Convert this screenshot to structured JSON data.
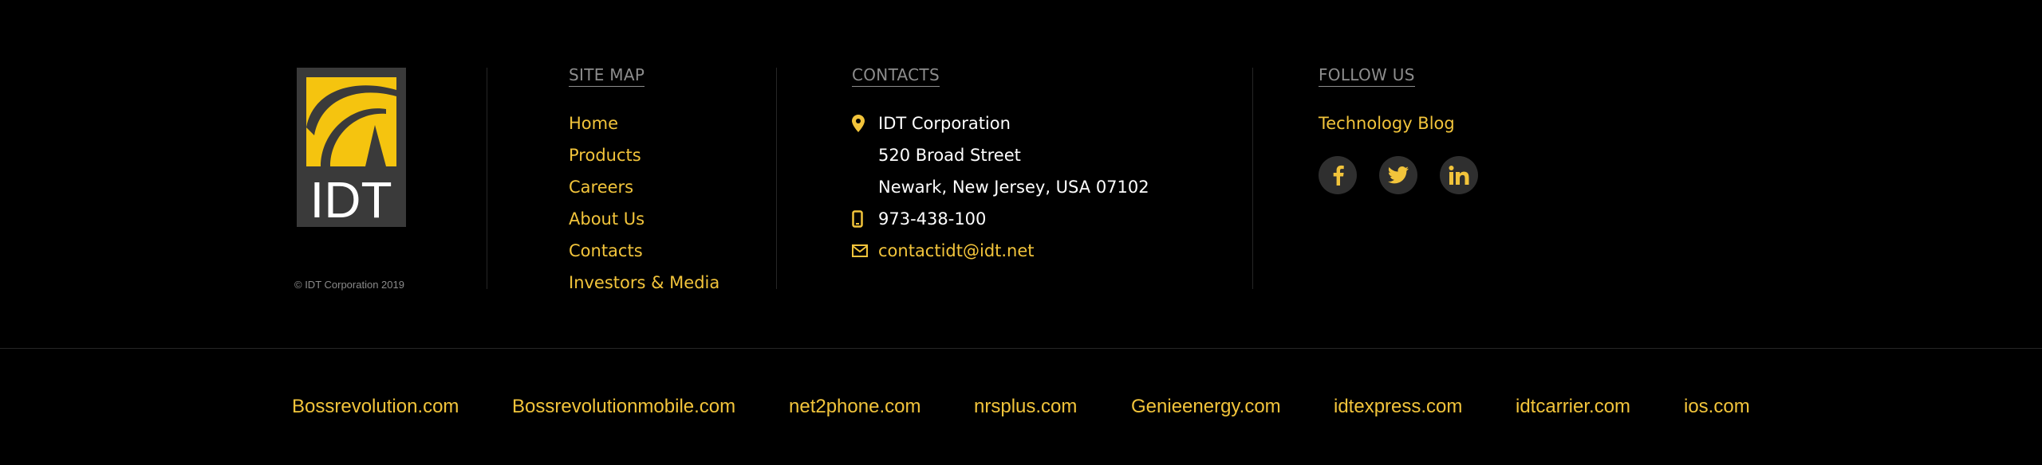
{
  "brand": {
    "logo_text": "IDT",
    "copyright": "© IDT Corporation 2019",
    "accent_color": "#f2c43b"
  },
  "sitemap": {
    "title": "SITE MAP",
    "items": [
      {
        "label": "Home"
      },
      {
        "label": "Products"
      },
      {
        "label": "Careers"
      },
      {
        "label": "About Us"
      },
      {
        "label": "Contacts"
      },
      {
        "label": "Investors & Media"
      }
    ]
  },
  "contacts": {
    "title": "CONTACTS",
    "company": "IDT Corporation",
    "address_line1": "520 Broad Street",
    "address_line2": "Newark, New Jersey, USA 07102",
    "phone": "973-438-100",
    "email": "contactidt@idt.net",
    "icons": [
      "map-pin-icon",
      "phone-icon",
      "mail-icon"
    ]
  },
  "follow": {
    "title": "FOLLOW US",
    "blog_link": "Technology Blog",
    "social": [
      "facebook-icon",
      "twitter-icon",
      "linkedin-icon"
    ]
  },
  "sites": [
    "Bossrevolution.com",
    "Bossrevolutionmobile.com",
    "net2phone.com",
    "nrsplus.com",
    "Genieenergy.com",
    "idtexpress.com",
    "idtcarrier.com",
    "ios.com"
  ]
}
